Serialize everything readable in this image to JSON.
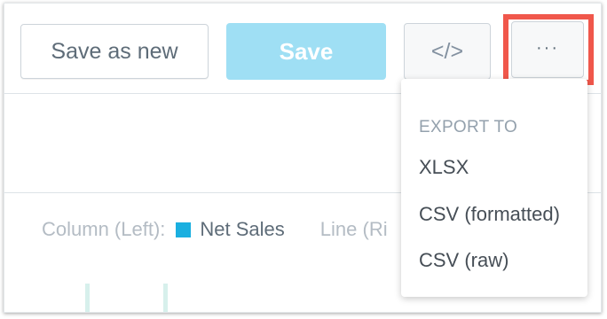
{
  "toolbar": {
    "save_as_new_label": "Save as new",
    "save_label": "Save",
    "embed_label": "</>",
    "more_label": "···"
  },
  "legend": {
    "column_label": "Column (Left):",
    "series_name": "Net Sales",
    "series_color": "#1aafe0",
    "line_label": "Line (Ri"
  },
  "export_menu": {
    "header": "EXPORT TO",
    "items": [
      "XLSX",
      "CSV (formatted)",
      "CSV (raw)"
    ]
  },
  "colors": {
    "highlight": "#f0574b",
    "primary_button": "#9fdff4"
  }
}
